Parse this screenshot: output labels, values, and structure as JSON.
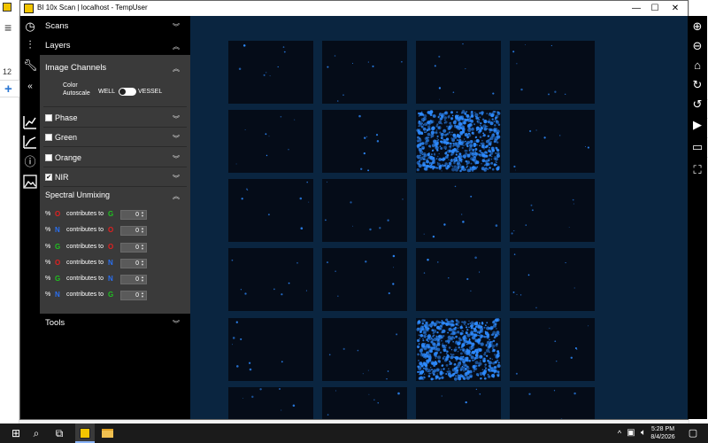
{
  "window": {
    "title": "BI 10x Scan | localhost - TempUser",
    "minimize": "—",
    "maximize": "☐",
    "close": "✕"
  },
  "background_app": {
    "number": "12",
    "right_text": "PM"
  },
  "panel": {
    "scans_label": "Scans",
    "layers_label": "Layers",
    "image_channels_label": "Image Channels",
    "color_autoscale_label": "Color\nAutoscale",
    "toggle_left": "WELL",
    "toggle_right": "VESSEL",
    "channels": [
      {
        "label": "Phase",
        "checked": false
      },
      {
        "label": "Green",
        "checked": false
      },
      {
        "label": "Orange",
        "checked": false
      },
      {
        "label": "NIR",
        "checked": true
      }
    ],
    "spectral_unmixing_label": "Spectral Unmixing",
    "unmix_rows": [
      {
        "pct": "%",
        "from": "O",
        "from_color": "#e02020",
        "text": "contributes to",
        "to": "G",
        "to_color": "#20c020",
        "value": "0"
      },
      {
        "pct": "%",
        "from": "N",
        "from_color": "#2a6ff0",
        "text": "contributes to",
        "to": "O",
        "to_color": "#e02020",
        "value": "0"
      },
      {
        "pct": "%",
        "from": "G",
        "from_color": "#20c020",
        "text": "contributes to",
        "to": "O",
        "to_color": "#e02020",
        "value": "0"
      },
      {
        "pct": "%",
        "from": "O",
        "from_color": "#e02020",
        "text": "contributes to",
        "to": "N",
        "to_color": "#2a6ff0",
        "value": "0"
      },
      {
        "pct": "%",
        "from": "G",
        "from_color": "#20c020",
        "text": "contributes to",
        "to": "N",
        "to_color": "#2a6ff0",
        "value": "0"
      },
      {
        "pct": "%",
        "from": "N",
        "from_color": "#2a6ff0",
        "text": "contributes to",
        "to": "G",
        "to_color": "#20c020",
        "value": "0"
      }
    ],
    "tools_label": "Tools",
    "collapse_icon": "«"
  },
  "taskbar": {
    "time": "5:28 PM",
    "date": "8/4/2026"
  },
  "colors": {
    "viewer_bg": "#0a2540",
    "tile_bg": "#050c18",
    "fluorescence": "#2e8bff"
  }
}
